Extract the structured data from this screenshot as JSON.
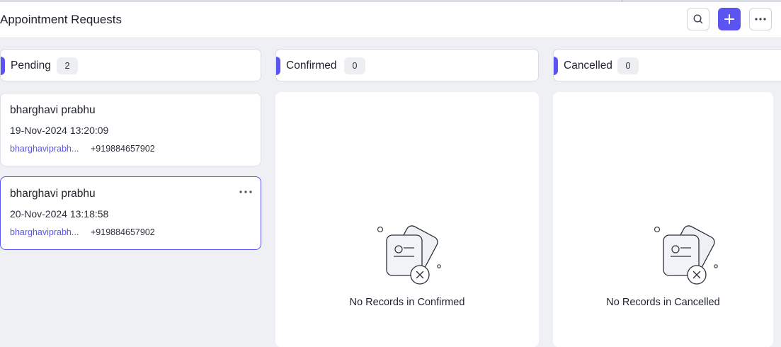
{
  "header": {
    "title": "Appointment Requests",
    "search_icon": "search-icon",
    "add_icon": "plus-icon",
    "more_icon": "more-horizontal-icon"
  },
  "accent_color": "#5b54f0",
  "columns": [
    {
      "name": "Pending",
      "count": "2",
      "cards": [
        {
          "name": "bharghavi prabhu",
          "datetime": "19-Nov-2024 13:20:09",
          "email": "bharghaviprabh...",
          "phone": "+919884657902"
        },
        {
          "name": "bharghavi prabhu",
          "datetime": "20-Nov-2024 13:18:58",
          "email": "bharghaviprabh...",
          "phone": "+919884657902",
          "selected": true
        }
      ]
    },
    {
      "name": "Confirmed",
      "count": "0",
      "empty_message": "No Records in Confirmed"
    },
    {
      "name": "Cancelled",
      "count": "0",
      "empty_message": "No Records in Cancelled"
    }
  ]
}
